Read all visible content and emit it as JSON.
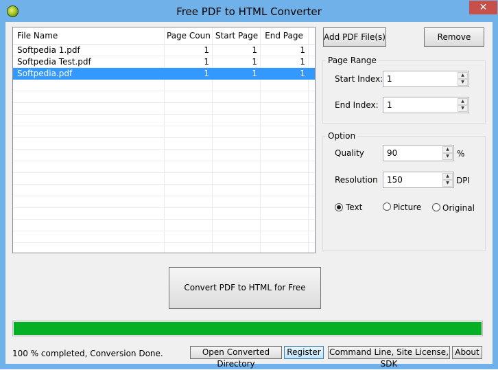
{
  "window": {
    "title": "Free PDF to HTML Converter",
    "close_glyph": "✕"
  },
  "file_list": {
    "columns": [
      "File Name",
      "Page Count",
      "Start Page",
      "End Page"
    ],
    "rows": [
      {
        "name": "Softpedia 1.pdf",
        "page_count": "1",
        "start_page": "1",
        "end_page": "1"
      },
      {
        "name": "Softpedia Test.pdf",
        "page_count": "1",
        "start_page": "1",
        "end_page": "1"
      },
      {
        "name": "Softpedia.pdf",
        "page_count": "1",
        "start_page": "1",
        "end_page": "1",
        "selected": true
      }
    ]
  },
  "buttons": {
    "add": "Add PDF File(s)",
    "remove": "Remove",
    "convert": "Convert PDF to HTML for Free",
    "open_dir": "Open Converted Directory",
    "register": "Register",
    "cmdline": "Command Line, Site License, SDK",
    "about": "About"
  },
  "page_range": {
    "title": "Page Range",
    "start_label": "Start Index:",
    "start_value": "1",
    "end_label": "End Index:",
    "end_value": "1"
  },
  "option": {
    "title": "Option",
    "quality_label": "Quality",
    "quality_value": "90",
    "quality_unit": "%",
    "resolution_label": "Resolution",
    "resolution_value": "150",
    "resolution_unit": "DPI",
    "modes": [
      {
        "label": "Text",
        "selected": true
      },
      {
        "label": "Picture",
        "selected": false
      },
      {
        "label": "Original",
        "selected": false
      }
    ]
  },
  "progress": {
    "percent": 100,
    "color": "#06b025"
  },
  "status": "100 % completed, Conversion Done.",
  "icons": {
    "app": "app-logo-icon",
    "spin_up": "▲",
    "spin_down": "▼"
  }
}
